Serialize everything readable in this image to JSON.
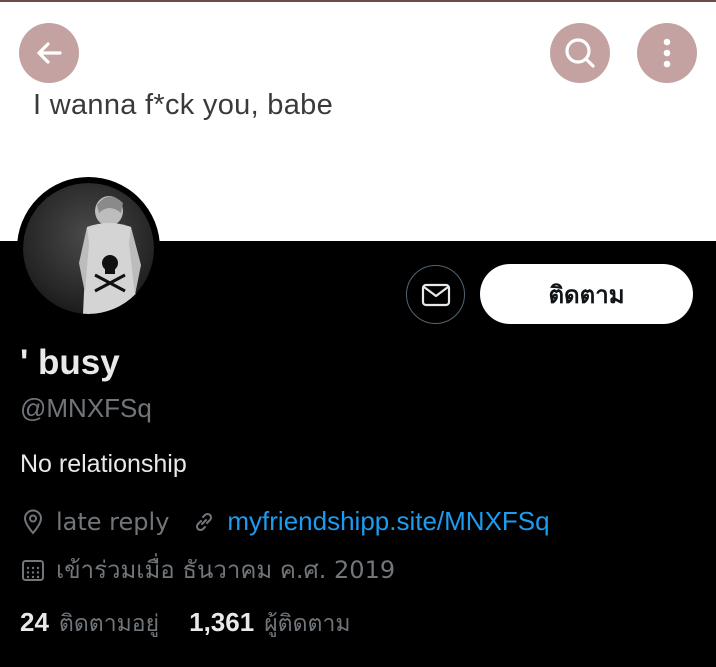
{
  "colors": {
    "header_button_bg": "#c4a2a2",
    "header_icon": "#ffffff",
    "link": "#1d9bf0",
    "secondary_text": "#71767b",
    "primary_text": "#e7e9ea",
    "background": "#000000",
    "banner": "#ffffff"
  },
  "header": {
    "back_icon": "arrow-left-icon",
    "search_icon": "search-icon",
    "more_icon": "more-vertical-icon"
  },
  "banner": {
    "text": "I wanna f*ck you, babe"
  },
  "profile": {
    "display_name": "' busy",
    "handle": "@MNXFSq",
    "bio": "No relationship",
    "location": "late reply",
    "link": "myfriendshipp.site/MNXFSq",
    "joined": "เข้าร่วมเมื่อ ธันวาคม ค.ศ. 2019"
  },
  "actions": {
    "message_icon": "envelope-icon",
    "follow_label": "ติดตาม"
  },
  "stats": {
    "following_count": "24",
    "following_label": "ติดตามอยู่",
    "followers_count": "1,361",
    "followers_label": "ผู้ติดตาม"
  }
}
